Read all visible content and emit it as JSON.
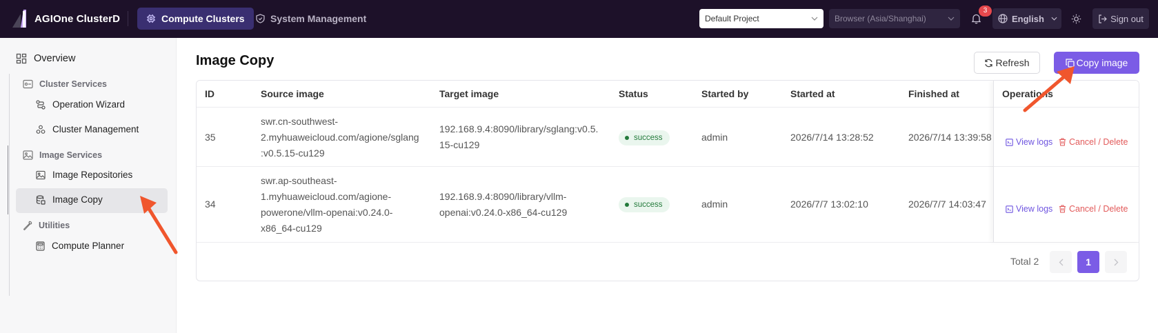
{
  "topbar": {
    "brand": "AGIOne ClusterD",
    "nav": [
      {
        "label": "Compute Clusters",
        "active": true
      },
      {
        "label": "System Management",
        "active": false
      }
    ],
    "project_select": "Default Project",
    "timezone_select": "Browser (Asia/Shanghai)",
    "notifications_count": "3",
    "language": "English",
    "sign_out": "Sign out"
  },
  "sidebar": {
    "overview": "Overview",
    "groups": [
      {
        "label": "Cluster Services",
        "items": [
          "Operation Wizard",
          "Cluster Management"
        ]
      },
      {
        "label": "Image Services",
        "items": [
          "Image Repositories",
          "Image Copy"
        ]
      },
      {
        "label": "Utilities",
        "items": [
          "Compute Planner"
        ]
      }
    ],
    "active_item": "Image Copy"
  },
  "main": {
    "title": "Image Copy",
    "refresh_label": "Refresh",
    "copy_label": "Copy image",
    "table": {
      "headers": [
        "ID",
        "Source image",
        "Target image",
        "Status",
        "Started by",
        "Started at",
        "Finished at",
        "Operations"
      ],
      "rows": [
        {
          "id": "35",
          "source": [
            "swr.cn-southwest-",
            "2.myhuaweicloud.com/agione/sglang",
            ":v0.5.15-cu129"
          ],
          "target": [
            "192.168.9.4:8090/library/sglang:v0.5.",
            "15-cu129"
          ],
          "status": "success",
          "started_by": "admin",
          "started_at": "2026/7/14 13:28:52",
          "finished_at": "2026/7/14 13:39:58",
          "op_view": "View logs",
          "op_cancel": "Cancel / Delete"
        },
        {
          "id": "34",
          "source": [
            "swr.ap-southeast-",
            "1.myhuaweicloud.com/agione-",
            "powerone/vllm-openai:v0.24.0-",
            "x86_64-cu129"
          ],
          "target": [
            "192.168.9.4:8090/library/vllm-",
            "openai:v0.24.0-x86_64-cu129"
          ],
          "status": "success",
          "started_by": "admin",
          "started_at": "2026/7/7 13:02:10",
          "finished_at": "2026/7/7 14:03:47",
          "op_view": "View logs",
          "op_cancel": "Cancel / Delete"
        }
      ]
    },
    "pagination": {
      "total": "Total 2",
      "current_page": "1"
    }
  },
  "colors": {
    "accent": "#7b5ce6",
    "topbar": "#1d1129",
    "annotation": "#f0562d",
    "success": "#237a3b",
    "danger": "#e25a5a"
  }
}
